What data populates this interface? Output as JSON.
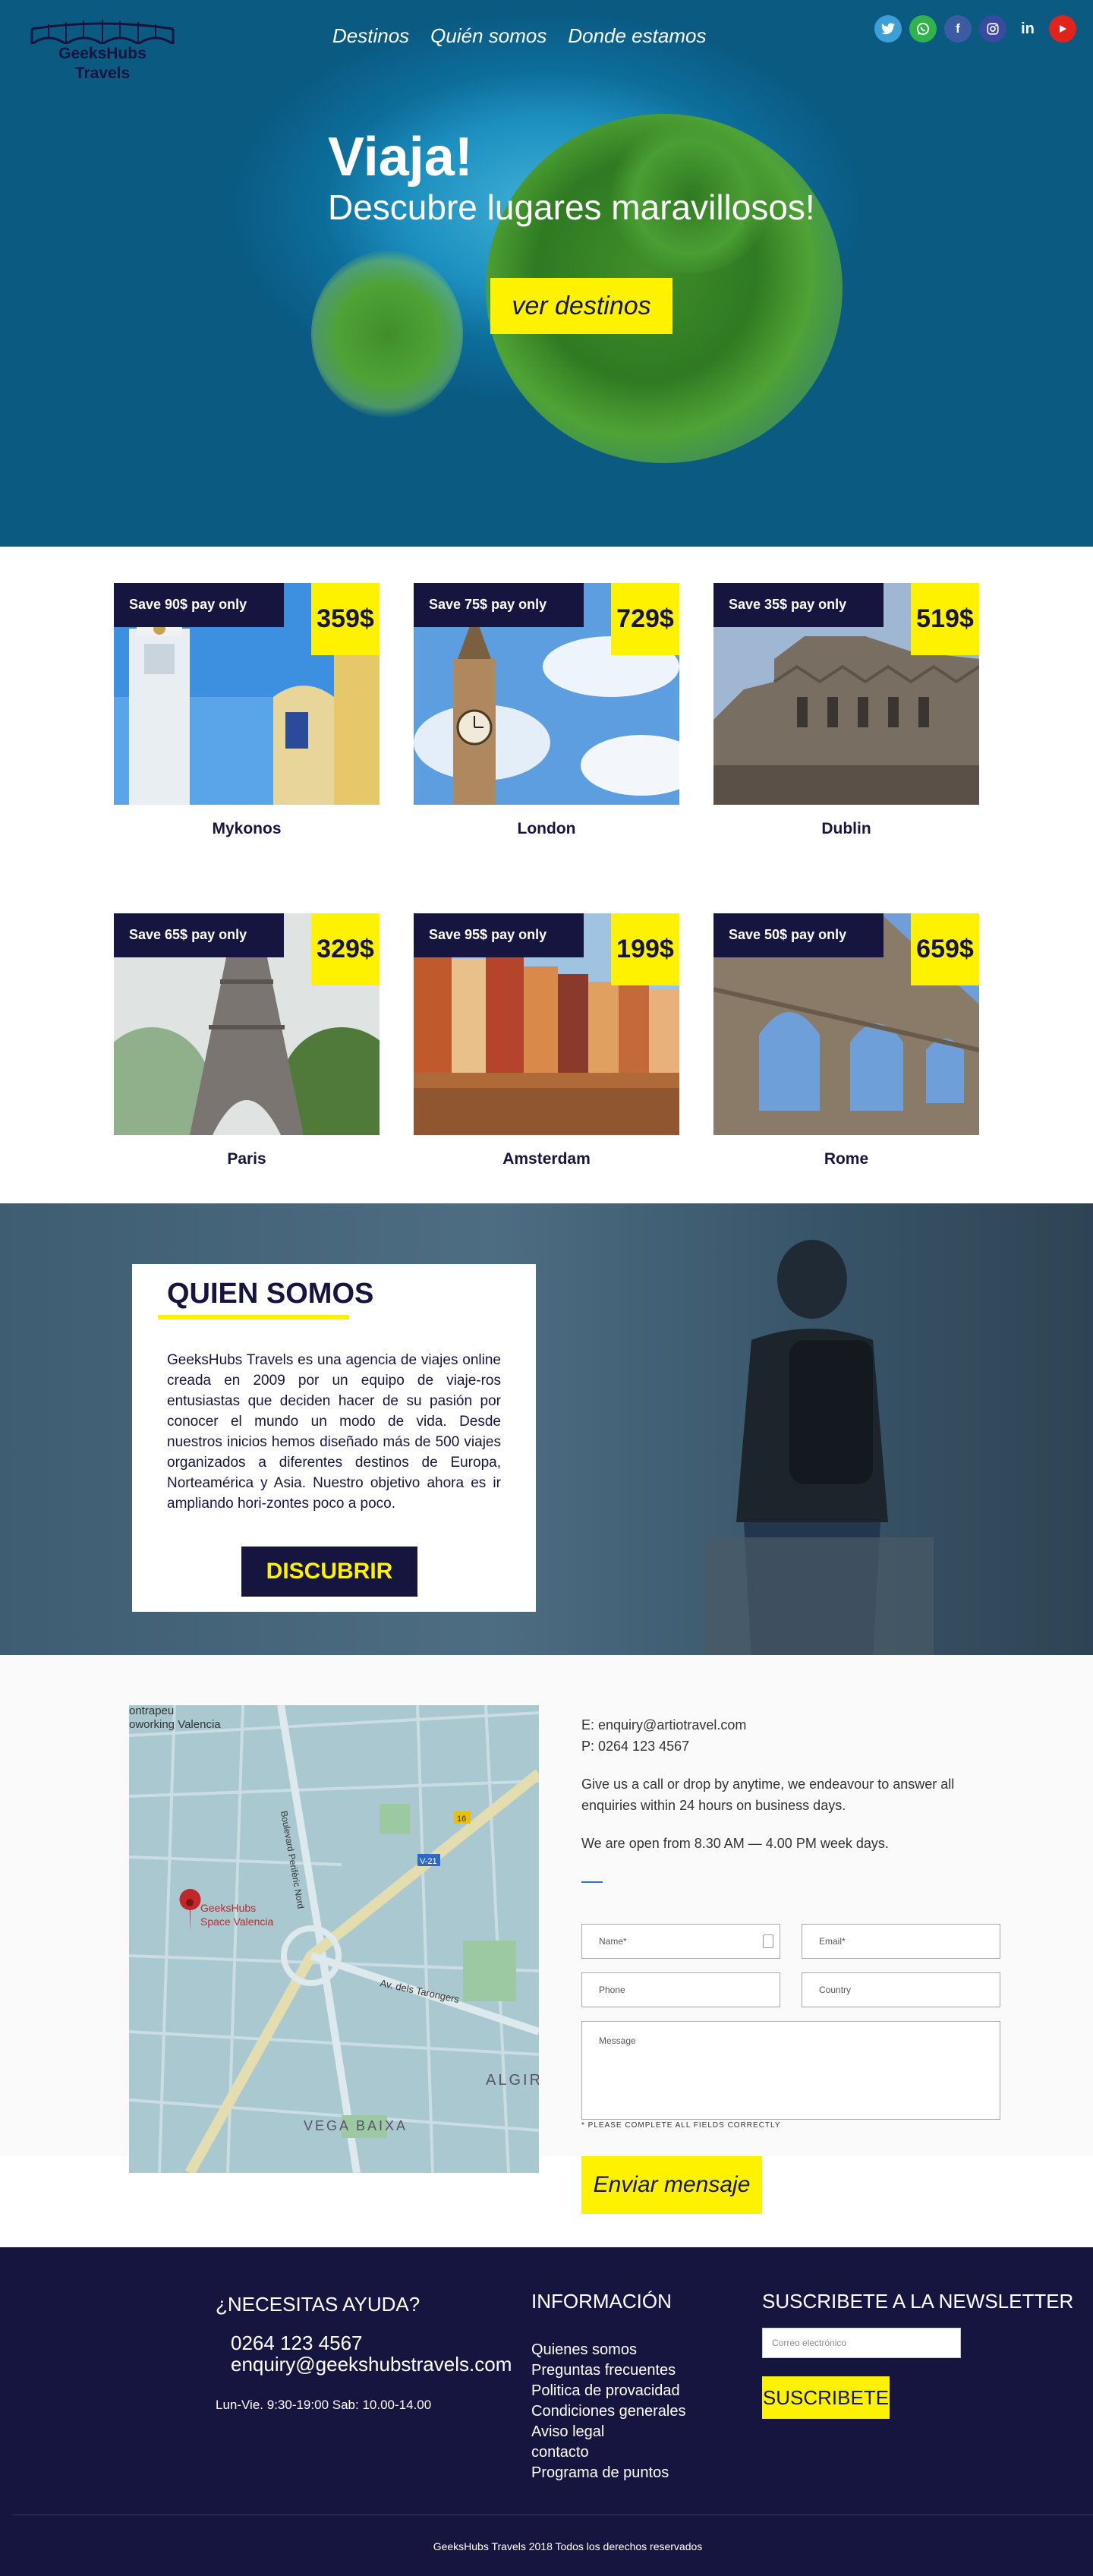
{
  "header": {
    "logo_line1": "GeeksHubs",
    "logo_line2": "Travels",
    "nav": [
      "Destinos",
      "Quién somos",
      "Donde estamos"
    ],
    "social_icons": [
      "twitter-icon",
      "whatsapp-icon",
      "facebook-icon",
      "instagram-icon",
      "linkedin-icon",
      "youtube-icon"
    ]
  },
  "hero": {
    "title": "Viaja!",
    "subtitle": "Descubre lugares maravillosos!",
    "button": "ver destinos"
  },
  "destinations": [
    {
      "save": "Save 90$ pay only",
      "price": "359$",
      "name": "Mykonos"
    },
    {
      "save": "Save 75$ pay only",
      "price": "729$",
      "name": "London"
    },
    {
      "save": "Save 35$ pay only",
      "price": "519$",
      "name": "Dublin"
    },
    {
      "save": "Save 65$ pay only",
      "price": "329$",
      "name": "Paris"
    },
    {
      "save": "Save 95$ pay only",
      "price": "199$",
      "name": "Amsterdam"
    },
    {
      "save": "Save 50$ pay only",
      "price": "659$",
      "name": "Rome"
    }
  ],
  "about": {
    "title": "QUIEN SOMOS",
    "text": "GeeksHubs Travels es una agencia de viajes online creada en 2009 por un equipo de viaje-ros entusiastas que deciden hacer de su pasión por conocer el mundo un modo de vida. Desde nuestros inicios hemos diseñado más de 500 viajes organizados a diferentes destinos de Europa, Norteamérica y Asia. Nuestro objetivo ahora es ir ampliando hori-zontes poco a poco.",
    "button": "DISCUBRIR"
  },
  "contact": {
    "map_labels": [
      "ontrapeu",
      "oworking Valencia",
      "Boulevard Perifèric Nord",
      "GeeksHubs",
      "Space Valencia",
      "Av. dels Tarongers",
      "VEGA BAIXA",
      "ALGIR",
      "V-21",
      "16"
    ],
    "email": "E: enquiry@artiotravel.com",
    "phone": "P: 0264 123 4567",
    "info1": "Give us a call or drop by anytime, we endeavour to answer all enquiries within 24 hours on business days.",
    "info2": "We are open from 8.30 AM — 4.00 PM week days.",
    "fields": {
      "name": "Name*",
      "email": "Email*",
      "phone": "Phone",
      "country": "Country",
      "message": "Message"
    },
    "note": "* PLEASE COMPLETE ALL FIELDS CORRECTLY",
    "send": "Enviar mensaje"
  },
  "footer": {
    "help_title": "¿NECESITAS AYUDA?",
    "help_phone": "0264 123 4567",
    "help_email": "enquiry@geekshubstravels.com",
    "hours": "Lun-Vie. 9:30-19:00 Sab: 10.00-14.00",
    "info_title": "INFORMACIÓN",
    "links": [
      "Quienes somos",
      "Preguntas frecuentes",
      "Politica de provacidad",
      "Condiciones generales",
      "Aviso legal",
      "contacto",
      "Programa de puntos"
    ],
    "newsletter_title": "SUSCRIBETE A LA NEWSLETTER",
    "newsletter_placeholder": "Correo electrónico",
    "subscribe": "SUSCRIBETE",
    "copyright": "GeeksHubs Travels 2018 Todos los derechos reservados"
  },
  "colors": {
    "navy": "#151540",
    "yellow": "#fff200",
    "twitter": "#3c9fd8",
    "whatsapp": "#2fb34a",
    "facebook": "#3b5ba3",
    "instagram": "#3a4a9e",
    "youtube": "#e0231b"
  }
}
